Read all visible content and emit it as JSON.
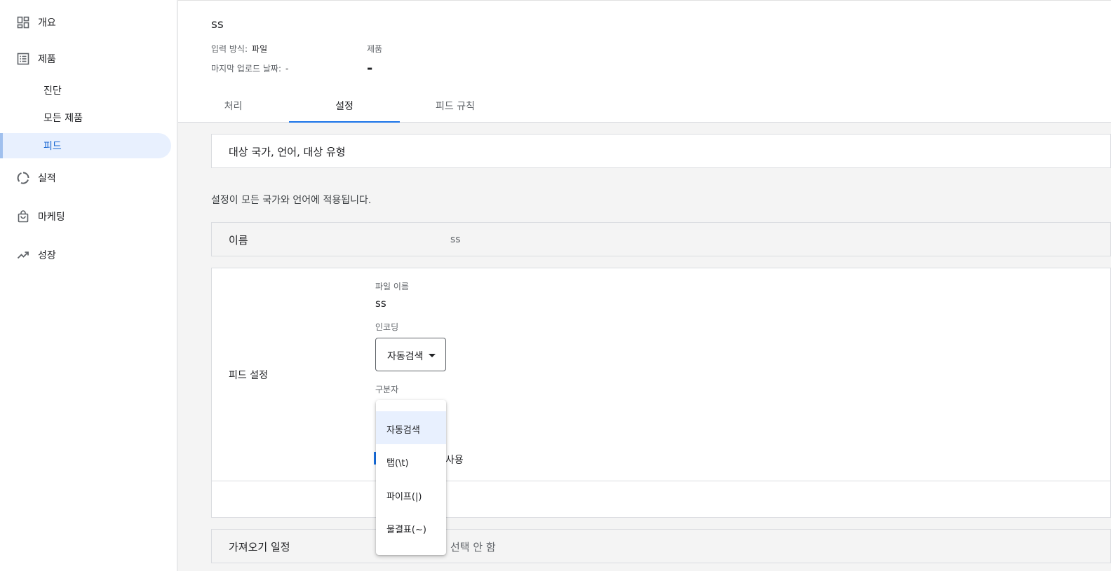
{
  "sidebar": {
    "items": [
      {
        "label": "개요",
        "icon": "dashboard-icon"
      },
      {
        "label": "제품",
        "icon": "list-icon"
      },
      {
        "label": "실적",
        "icon": "donut-chart-icon"
      },
      {
        "label": "마케팅",
        "icon": "shopping-bag-icon"
      },
      {
        "label": "성장",
        "icon": "trending-up-icon"
      }
    ],
    "subitems": [
      {
        "label": "진단"
      },
      {
        "label": "모든 제품"
      },
      {
        "label": "피드",
        "active": true
      }
    ]
  },
  "header": {
    "title": "ss",
    "input_method_label": "입력 방식:",
    "input_method_value": "파일",
    "last_upload_label": "마지막 업로드 날짜:",
    "last_upload_value": "-",
    "products_label": "제품",
    "products_value": "-"
  },
  "tabs": [
    {
      "label": "처리"
    },
    {
      "label": "설정",
      "active": true
    },
    {
      "label": "피드 규칙"
    }
  ],
  "settings": {
    "target_section": "대상 국가, 언어, 대상 유형",
    "apply_note": "설정이 모든 국가와 언어에 적용됩니다.",
    "name_label": "이름",
    "name_value": "ss",
    "feed_settings_label": "피드 설정",
    "file_name_label": "파일 이름",
    "file_name_value": "ss",
    "encoding_label": "인코딩",
    "encoding_value": "자동검색",
    "delimiter_label": "구분자",
    "checkbox_label_partial": "사용",
    "fetch_schedule_label": "가져오기 일정",
    "fetch_schedule_value": "선택 안 함"
  },
  "delimiter_menu": {
    "options": [
      "자동검색",
      "탭(\\t)",
      "파이프(|)",
      "물결표(~)"
    ],
    "selected": "자동검색"
  },
  "colors": {
    "accent": "#1a73e8",
    "active_bg": "#e8f0fe",
    "page_bg": "#f4f4f4"
  }
}
